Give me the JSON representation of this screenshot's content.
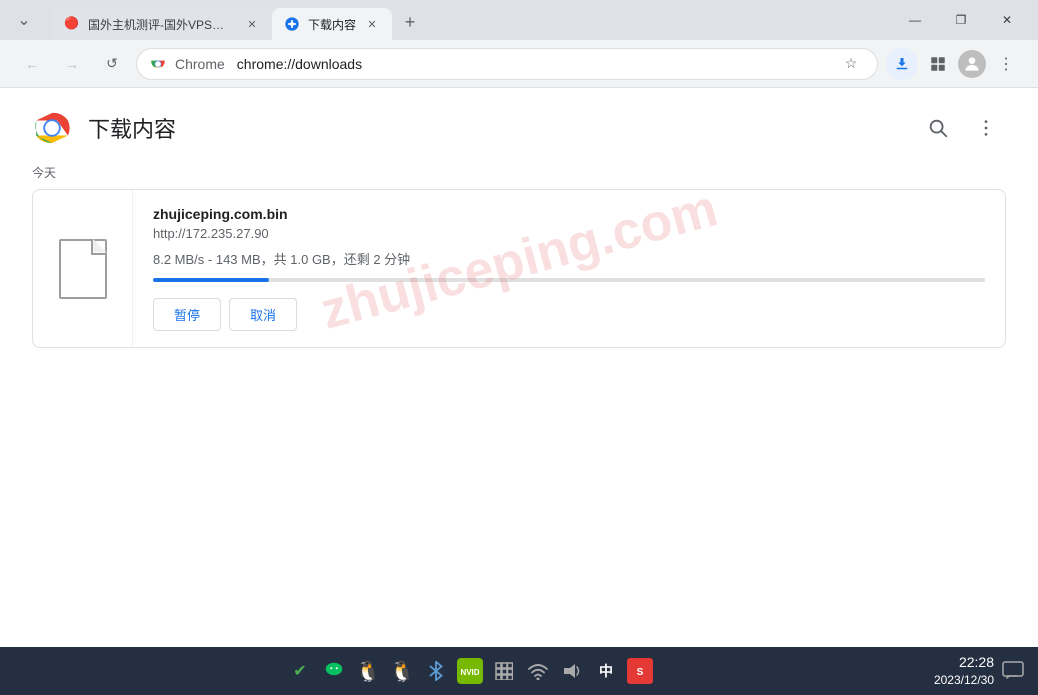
{
  "titleBar": {
    "tab1": {
      "title": "国外主机测评-国外VPS，国...",
      "favicon": "🔴"
    },
    "tab2": {
      "title": "下载内容",
      "favicon": "⬇️",
      "active": true
    },
    "newTab": "+",
    "minimize": "—",
    "maximize": "❐",
    "close": "✕"
  },
  "navBar": {
    "back": "←",
    "forward": "→",
    "refresh": "↺",
    "brandLabel": "Chrome",
    "url": "chrome://downloads",
    "bookmark": "☆",
    "downloadActive": true,
    "extensions": "⬜",
    "menu": "⋮"
  },
  "page": {
    "title": "下载内容",
    "searchLabel": "🔍",
    "menuLabel": "⋮"
  },
  "downloads": {
    "sectionLabel": "今天",
    "item": {
      "filename": "zhujiceping.com.bin",
      "url": "http://172.235.27.90",
      "progressText": "8.2 MB/s - 143 MB，共 1.0 GB，还剩 2 分钟",
      "progressPercent": 14,
      "pauseLabel": "暂停",
      "cancelLabel": "取消"
    }
  },
  "watermark": "zhujiceping.com",
  "taskbar": {
    "icons": [
      {
        "name": "check-icon",
        "char": "✅"
      },
      {
        "name": "wechat-icon",
        "char": "💬"
      },
      {
        "name": "penguin-icon",
        "char": "🐧"
      },
      {
        "name": "penguin2-icon",
        "char": "🐧"
      },
      {
        "name": "bluetooth-icon",
        "char": "🔵"
      },
      {
        "name": "nvidia-icon",
        "char": "🟩"
      },
      {
        "name": "grid-icon",
        "char": "⚡"
      },
      {
        "name": "wifi-icon",
        "char": "📶"
      },
      {
        "name": "volume-icon",
        "char": "🔊"
      },
      {
        "name": "input-icon",
        "char": "中"
      },
      {
        "name": "antivirus-icon",
        "char": "🛡️"
      }
    ],
    "time": "22:28",
    "date": "2023/12/30"
  }
}
